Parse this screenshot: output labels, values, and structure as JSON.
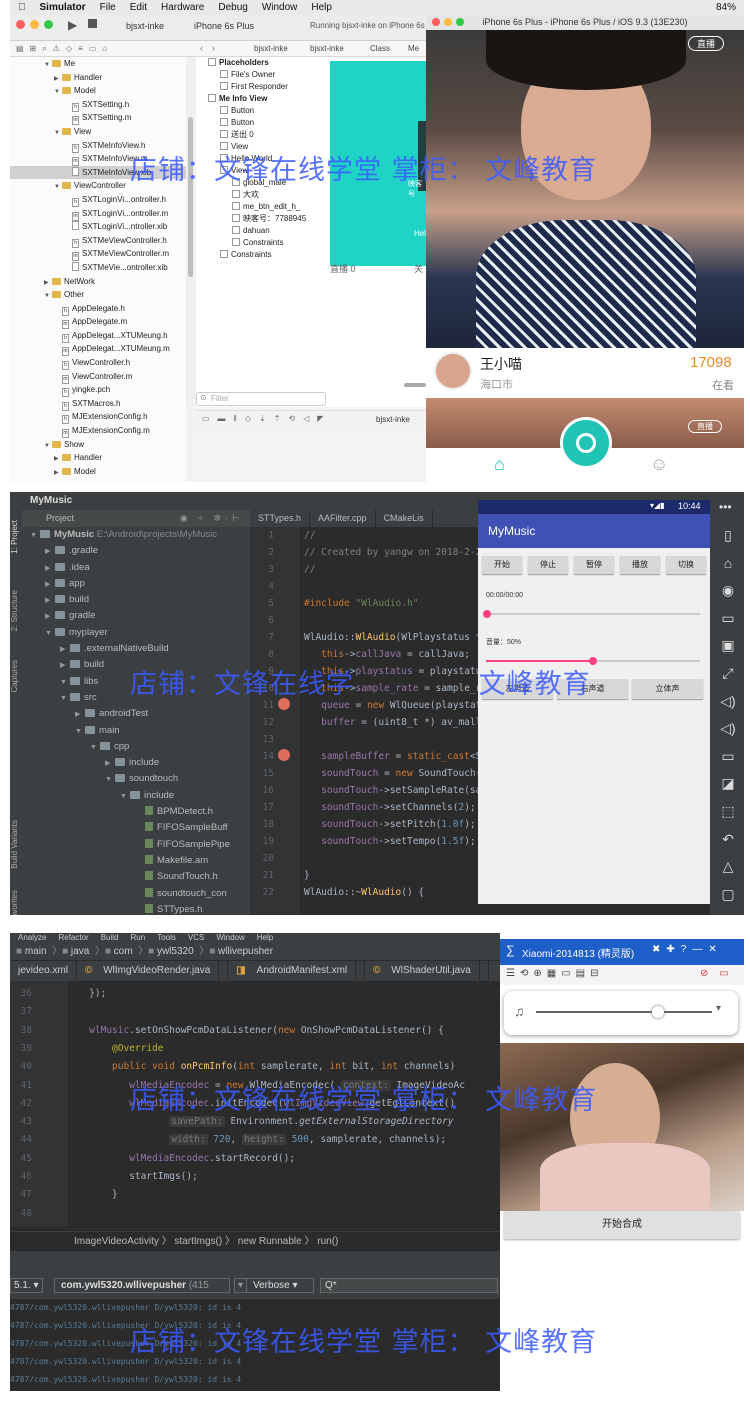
{
  "watermark": {
    "line1_prefix": "店铺：",
    "line1_middle": "文锋在线学堂",
    "line1_mid2": "掌柜：",
    "line1_suffix": "文峰教育",
    "p2_prefix": "店铺：",
    "p2_middle": "文锋在线学",
    "p2_suffix": "文峰教育",
    "p3_suffix": "文峰教育"
  },
  "panel1": {
    "menubar": [
      "Simulator",
      "File",
      "Edit",
      "Hardware",
      "Debug",
      "Window",
      "Help"
    ],
    "status_right": "84%",
    "scheme": "bjsxt-inke",
    "device": "iPhone 6s Plus",
    "run_status": "Running bjsxt-inke on iPhone 6s Plus",
    "jump": [
      "bjsxt-inke",
      "bjsxt-inke",
      "Class",
      "Me"
    ],
    "nav": [
      {
        "t": "Me",
        "lvl": 3,
        "k": "folder",
        "open": true
      },
      {
        "t": "Handler",
        "lvl": 4,
        "k": "folder"
      },
      {
        "t": "Model",
        "lvl": 4,
        "k": "folder",
        "open": true
      },
      {
        "t": "SXTSetting.h",
        "lvl": 5,
        "k": "h"
      },
      {
        "t": "SXTSetting.m",
        "lvl": 5,
        "k": "m"
      },
      {
        "t": "View",
        "lvl": 4,
        "k": "folder",
        "open": true
      },
      {
        "t": "SXTMeInfoView.h",
        "lvl": 5,
        "k": "h"
      },
      {
        "t": "SXTMeInfoView.m",
        "lvl": 5,
        "k": "m"
      },
      {
        "t": "SXTMeInfoView.xib",
        "lvl": 5,
        "k": "x",
        "sel": true
      },
      {
        "t": "ViewController",
        "lvl": 4,
        "k": "folder",
        "open": true
      },
      {
        "t": "SXTLoginVi...ontroller.h",
        "lvl": 5,
        "k": "h"
      },
      {
        "t": "SXTLoginVi...ontroller.m",
        "lvl": 5,
        "k": "m"
      },
      {
        "t": "SXTLoginVi...ntroller.xib",
        "lvl": 5,
        "k": "x"
      },
      {
        "t": "SXTMeViewController.h",
        "lvl": 5,
        "k": "h"
      },
      {
        "t": "SXTMeViewController.m",
        "lvl": 5,
        "k": "m"
      },
      {
        "t": "SXTMeVie...ontroller.xib",
        "lvl": 5,
        "k": "x"
      },
      {
        "t": "NetWork",
        "lvl": 3,
        "k": "folder"
      },
      {
        "t": "Other",
        "lvl": 3,
        "k": "folder",
        "open": true
      },
      {
        "t": "AppDelegate.h",
        "lvl": 4,
        "k": "h"
      },
      {
        "t": "AppDelegate.m",
        "lvl": 4,
        "k": "m"
      },
      {
        "t": "AppDelegat...XTUMeung.h",
        "lvl": 4,
        "k": "h"
      },
      {
        "t": "AppDelegat...XTUMeung.m",
        "lvl": 4,
        "k": "m"
      },
      {
        "t": "ViewController.h",
        "lvl": 4,
        "k": "h"
      },
      {
        "t": "ViewController.m",
        "lvl": 4,
        "k": "m"
      },
      {
        "t": "yingke.pch",
        "lvl": 4,
        "k": "h"
      },
      {
        "t": "SXTMacros.h",
        "lvl": 4,
        "k": "h"
      },
      {
        "t": "MJExtensionConfig.h",
        "lvl": 4,
        "k": "h"
      },
      {
        "t": "MJExtensionConfig.m",
        "lvl": 4,
        "k": "m"
      },
      {
        "t": "Show",
        "lvl": 3,
        "k": "folder",
        "open": true
      },
      {
        "t": "Handler",
        "lvl": 4,
        "k": "folder"
      },
      {
        "t": "Model",
        "lvl": 4,
        "k": "folder"
      }
    ],
    "outline": [
      {
        "t": "Placeholders",
        "lvl": 0,
        "b": true
      },
      {
        "t": "File's Owner",
        "lvl": 1
      },
      {
        "t": "First Responder",
        "lvl": 1
      },
      {
        "t": "Me Info View",
        "lvl": 0,
        "b": true
      },
      {
        "t": "Button",
        "lvl": 1
      },
      {
        "t": "Button",
        "lvl": 1
      },
      {
        "t": "送出 0",
        "lvl": 1
      },
      {
        "t": "View",
        "lvl": 1
      },
      {
        "t": "Hello World",
        "lvl": 1
      },
      {
        "t": "View",
        "lvl": 1
      },
      {
        "t": "global_male",
        "lvl": 2
      },
      {
        "t": "大欢",
        "lvl": 2
      },
      {
        "t": "me_btn_edit_h_",
        "lvl": 2
      },
      {
        "t": "映客号：7788945",
        "lvl": 2
      },
      {
        "t": "dahuan",
        "lvl": 2
      },
      {
        "t": "Constraints",
        "lvl": 2
      },
      {
        "t": "Constraints",
        "lvl": 1
      }
    ],
    "filter_placeholder": "Filter",
    "scheme_bottom": "bjsxt-inke",
    "canvas_labels": [
      "映客号",
      "Hello",
      "直播 0",
      "关"
    ],
    "sim_title": "iPhone 6s Plus - iPhone 6s Plus / iOS 9.3 (13E230)",
    "live_badge": "直播",
    "host_name": "王小喵",
    "host_city": "海口市",
    "viewers": "17098",
    "viewer_label": "在看",
    "live_badge2": "直播"
  },
  "panel2": {
    "title": "MyMusic",
    "side_labels": [
      "1: Project",
      "2: Structure",
      "Captures",
      "Build Variants",
      "Favorites"
    ],
    "proj_header": "Project",
    "tree": [
      {
        "t": "MyMusic",
        "p": "E:\\Android\\projects\\MyMusic",
        "lvl": 0,
        "k": "fld",
        "b": true
      },
      {
        "t": ".gradle",
        "lvl": 1,
        "k": "fld",
        "c": true
      },
      {
        "t": ".idea",
        "lvl": 1,
        "k": "fld",
        "c": true
      },
      {
        "t": "app",
        "lvl": 1,
        "k": "fld",
        "c": true
      },
      {
        "t": "build",
        "lvl": 1,
        "k": "fld",
        "c": true
      },
      {
        "t": "gradle",
        "lvl": 1,
        "k": "fld",
        "c": true
      },
      {
        "t": "myplayer",
        "lvl": 1,
        "k": "fld"
      },
      {
        "t": ".externalNativeBuild",
        "lvl": 2,
        "k": "fld",
        "c": true
      },
      {
        "t": "build",
        "lvl": 2,
        "k": "fld",
        "c": true
      },
      {
        "t": "libs",
        "lvl": 2,
        "k": "fld"
      },
      {
        "t": "src",
        "lvl": 2,
        "k": "fld"
      },
      {
        "t": "androidTest",
        "lvl": 3,
        "k": "fld",
        "c": true
      },
      {
        "t": "main",
        "lvl": 3,
        "k": "fld"
      },
      {
        "t": "cpp",
        "lvl": 4,
        "k": "fld"
      },
      {
        "t": "include",
        "lvl": 5,
        "k": "fld",
        "c": true
      },
      {
        "t": "soundtouch",
        "lvl": 5,
        "k": "fld"
      },
      {
        "t": "include",
        "lvl": 6,
        "k": "fld"
      },
      {
        "t": "BPMDetect.h",
        "lvl": 7,
        "k": "fil"
      },
      {
        "t": "FIFOSampleBuff",
        "lvl": 7,
        "k": "fil"
      },
      {
        "t": "FIFOSamplePipe",
        "lvl": 7,
        "k": "fil"
      },
      {
        "t": "Makefile.am",
        "lvl": 7,
        "k": "fil"
      },
      {
        "t": "SoundTouch.h",
        "lvl": 7,
        "k": "fil"
      },
      {
        "t": "soundtouch_con",
        "lvl": 7,
        "k": "fil"
      },
      {
        "t": "STTypes.h",
        "lvl": 7,
        "k": "fil"
      }
    ],
    "tabs": [
      "STTypes.h",
      "AAFilter.cpp",
      "CMakeLis"
    ],
    "code": [
      {
        "n": "1",
        "h": "<span class='cm'>//</span>"
      },
      {
        "n": "2",
        "h": "<span class='cm'>// Created by yangw on 2018-2-28.</span>"
      },
      {
        "n": "3",
        "h": "<span class='cm'>//</span>"
      },
      {
        "n": "4",
        "h": ""
      },
      {
        "n": "5",
        "h": "<span class='kw'>#include</span> <span class='st'>\"WlAudio.h\"</span>"
      },
      {
        "n": "6",
        "h": ""
      },
      {
        "n": "7",
        "h": "WlAudio::<span class='fn'>WlAudio</span>(WlPlaystatus *pl"
      },
      {
        "n": "8",
        "h": "&nbsp;&nbsp;&nbsp;<span class='kw'>this</span>-&gt;<span class='pu'>callJava</span> = callJava;"
      },
      {
        "n": "9",
        "h": "&nbsp;&nbsp;&nbsp;<span class='kw'>this</span>-&gt;<span class='pu'>playstatus</span> = playstatus;"
      },
      {
        "n": "10",
        "h": "&nbsp;&nbsp;&nbsp;<span class='kw'>this</span>-&gt;<span class='pu'>sample_rate</span> = sample_ra"
      },
      {
        "n": "11",
        "h": "&nbsp;&nbsp;&nbsp;<span class='pu'>queue</span> = <span class='kw'>new</span> WlQueue(playstatu"
      },
      {
        "n": "12",
        "h": "&nbsp;&nbsp;&nbsp;<span class='pu'>buffer</span> = (uint8_t *) av_mallo"
      },
      {
        "n": "13",
        "h": ""
      },
      {
        "n": "14",
        "h": "&nbsp;&nbsp;&nbsp;<span class='pu'>sampleBuffer</span> = <span class='kw'>static_cast</span>&lt;S"
      },
      {
        "n": "15",
        "h": "&nbsp;&nbsp;&nbsp;<span class='pu'>soundTouch</span> = <span class='kw'>new</span> SoundTouch()"
      },
      {
        "n": "16",
        "h": "&nbsp;&nbsp;&nbsp;<span class='pu'>soundTouch</span>-&gt;setSampleRate(sam"
      },
      {
        "n": "17",
        "h": "&nbsp;&nbsp;&nbsp;<span class='pu'>soundTouch</span>-&gt;setChannels(<span class='num'>2</span>);"
      },
      {
        "n": "18",
        "h": "&nbsp;&nbsp;&nbsp;<span class='pu'>soundTouch</span>-&gt;setPitch(<span class='num'>1.0f</span>);"
      },
      {
        "n": "19",
        "h": "&nbsp;&nbsp;&nbsp;<span class='pu'>soundTouch</span>-&gt;setTempo(<span class='num'>1.5f</span>);"
      },
      {
        "n": "20",
        "h": ""
      },
      {
        "n": "21",
        "h": "}"
      },
      {
        "n": "22",
        "h": "WlAudio::~<span class='fn'>WlAudio</span>() {"
      }
    ],
    "phone": {
      "time": "10:44",
      "app": "MyMusic",
      "buttons": [
        "开始",
        "停止",
        "暂停",
        "播放",
        "切换"
      ],
      "time_label": "00:00/00:00",
      "volume": "音量：50%",
      "volume_value": 0.5,
      "channels": [
        "左声道",
        "右声道",
        "立体声"
      ]
    }
  },
  "panel3": {
    "menu": [
      "Analyze",
      "Refactor",
      "Build",
      "Run",
      "Tools",
      "VCS",
      "Window",
      "Help"
    ],
    "crumb": [
      "main",
      "java",
      "com",
      "ywl5320",
      "wllivepusher"
    ],
    "tabs": [
      "jevideo.xml",
      "WlImgVideoRender.java",
      "AndroidManifest.xml",
      "WlShaderUtil.java"
    ],
    "code": [
      {
        "n": "36",
        "h": "&nbsp;&nbsp;&nbsp;});"
      },
      {
        "n": "37",
        "h": ""
      },
      {
        "n": "38",
        "h": "&nbsp;&nbsp;&nbsp;<span class='pu'>wlMusic</span>.setOnShowPcmDataListener(<span class='kw'>new</span> OnShowPcmDataListener() {"
      },
      {
        "n": "39",
        "h": "&nbsp;&nbsp;&nbsp;&nbsp;&nbsp;&nbsp;&nbsp;<span class='an'>@Override</span>"
      },
      {
        "n": "40",
        "h": "&nbsp;&nbsp;&nbsp;&nbsp;&nbsp;&nbsp;&nbsp;<span class='kw'>public void</span> <span class='fn'>onPcmInfo</span>(<span class='kw'>int</span> samplerate, <span class='kw'>int</span> bit, <span class='kw'>int</span> channels)"
      },
      {
        "n": "41",
        "h": "&nbsp;&nbsp;&nbsp;&nbsp;&nbsp;&nbsp;&nbsp;&nbsp;&nbsp;&nbsp;<span class='pu'>wlMediaEncodec</span> = <span class='kw'>new</span> WlMediaEncodec( <span class='hint'>context:</span> ImageVideoAc"
      },
      {
        "n": "42",
        "h": "&nbsp;&nbsp;&nbsp;&nbsp;&nbsp;&nbsp;&nbsp;&nbsp;&nbsp;&nbsp;<span class='pu'>wlMediaEncodec</span>.initEncodec(<span class='pu'>wlImgVideoView</span>.getEglContext()"
      },
      {
        "n": "43",
        "h": "&nbsp;&nbsp;&nbsp;&nbsp;&nbsp;&nbsp;&nbsp;&nbsp;&nbsp;&nbsp;&nbsp;&nbsp;&nbsp;&nbsp;&nbsp;&nbsp;&nbsp;<span class='hint'>savePath:</span> Environment.<i>getExternalStorageDirectory</i>"
      },
      {
        "n": "44",
        "h": "&nbsp;&nbsp;&nbsp;&nbsp;&nbsp;&nbsp;&nbsp;&nbsp;&nbsp;&nbsp;&nbsp;&nbsp;&nbsp;&nbsp;&nbsp;&nbsp;&nbsp;<span class='hint'>width:</span> <span class='num'>720</span>, <span class='hint'>height:</span> <span class='num'>500</span>, samplerate, channels);"
      },
      {
        "n": "45",
        "h": "&nbsp;&nbsp;&nbsp;&nbsp;&nbsp;&nbsp;&nbsp;&nbsp;&nbsp;&nbsp;<span class='pu'>wlMediaEncodec</span>.startRecord();"
      },
      {
        "n": "46",
        "h": "&nbsp;&nbsp;&nbsp;&nbsp;&nbsp;&nbsp;&nbsp;&nbsp;&nbsp;&nbsp;startImgs();"
      },
      {
        "n": "47",
        "h": "&nbsp;&nbsp;&nbsp;&nbsp;&nbsp;&nbsp;&nbsp;}"
      },
      {
        "n": "48",
        "h": ""
      }
    ],
    "structure_crumb": [
      "ImageVideoActivity",
      "startImgs()",
      "new Runnable",
      "run()"
    ],
    "device": "5.1.",
    "package": "com.ywl5320.wllivepusher",
    "pid": "(415",
    "level": "Verbose",
    "search": "Q*",
    "log_line": "4787/com.ywl5320.wllivepusher D/ywl5320: id is  4",
    "phone_title": "Xiaomi-2014813 (精灵版)",
    "start_btn": "开始合成"
  }
}
